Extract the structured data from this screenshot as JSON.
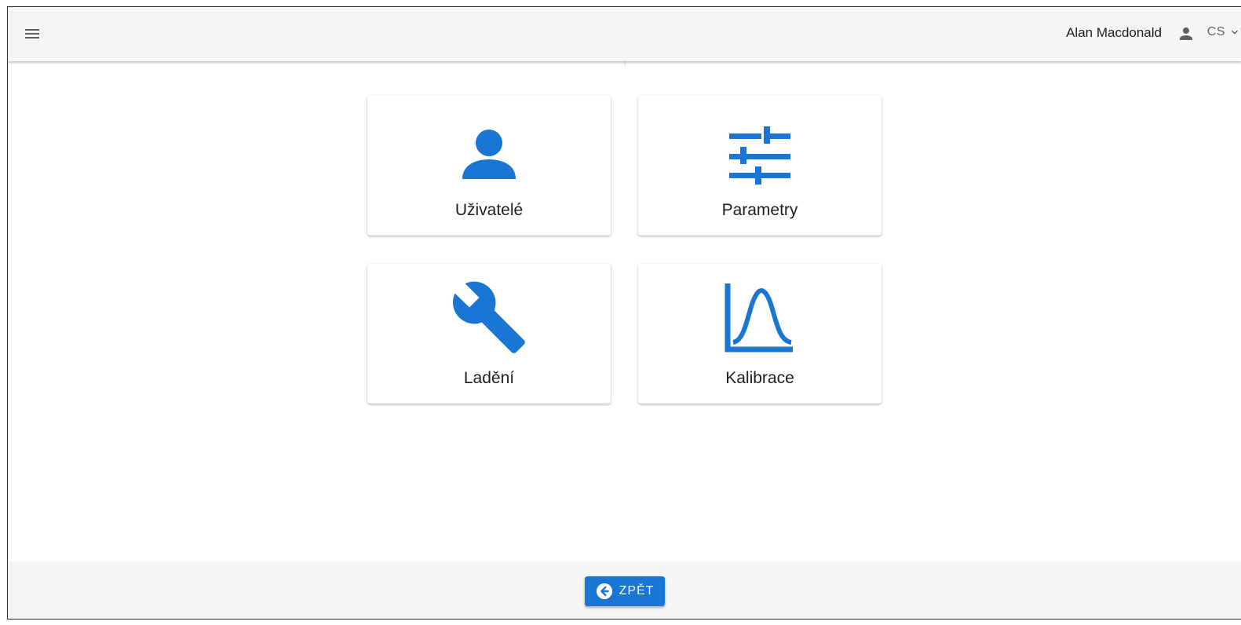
{
  "header": {
    "user_name": "Alan Macdonald",
    "language": "CS",
    "menu_icon": "hamburger-menu-icon",
    "user_icon": "person-icon",
    "language_icon": "chevron-down-icon"
  },
  "tiles": [
    {
      "label": "Uživatelé",
      "icon": "person-icon"
    },
    {
      "label": "Parametry",
      "icon": "tune-sliders-icon"
    },
    {
      "label": "Ladění",
      "icon": "wrench-icon"
    },
    {
      "label": "Kalibrace",
      "icon": "bell-curve-icon"
    }
  ],
  "footer": {
    "back_label": "ZPĚT",
    "back_icon": "arrow-left-circle-icon"
  },
  "colors": {
    "accent": "#1976d2",
    "bar_background": "#f5f5f5",
    "text": "#1f1f1f"
  }
}
